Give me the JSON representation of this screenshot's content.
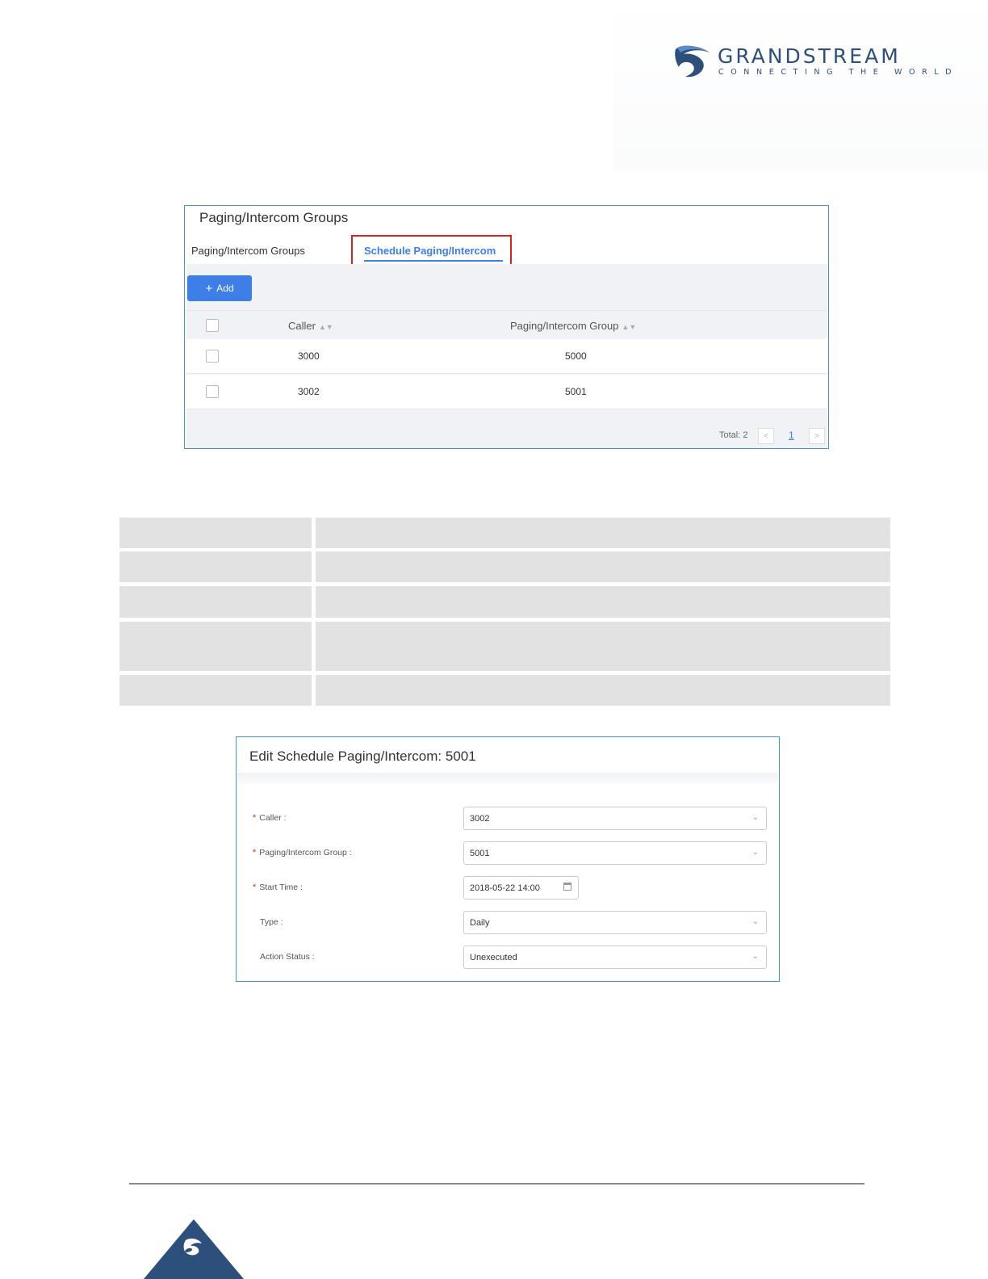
{
  "brand": {
    "name": "GRANDSTREAM",
    "tagline": "CONNECTING THE WORLD",
    "color": "#2d4f7c"
  },
  "panel1": {
    "title": "Paging/Intercom Groups",
    "tabs": [
      {
        "label": "Paging/Intercom Groups",
        "active": false
      },
      {
        "label": "Schedule Paging/Intercom",
        "active": true
      }
    ],
    "add_label": "Add",
    "columns": [
      "Caller",
      "Paging/Intercom Group"
    ],
    "rows": [
      {
        "caller": "3000",
        "group": "5000"
      },
      {
        "caller": "3002",
        "group": "5001"
      }
    ],
    "pagination": {
      "total_label": "Total: 2",
      "prev": "<",
      "page": "1",
      "next": ">"
    },
    "accent_color": "#3d7ee8",
    "highlight_color": "#e02020"
  },
  "panel2": {
    "title": "Edit Schedule Paging/Intercom: 5001",
    "fields": [
      {
        "label": "Caller :",
        "required": true,
        "value": "3002",
        "kind": "select"
      },
      {
        "label": "Paging/Intercom Group :",
        "required": true,
        "value": "5001",
        "kind": "select"
      },
      {
        "label": "Start Time :",
        "required": true,
        "value": "2018-05-22 14:00",
        "kind": "date"
      },
      {
        "label": "Type :",
        "required": false,
        "value": "Daily",
        "kind": "select"
      },
      {
        "label": "Action Status :",
        "required": false,
        "value": "Unexecuted",
        "kind": "select"
      }
    ]
  },
  "icons": {
    "sort": "sort-arrows-icon",
    "dropdown": "chevron-down-icon",
    "calendar": "calendar-icon"
  }
}
